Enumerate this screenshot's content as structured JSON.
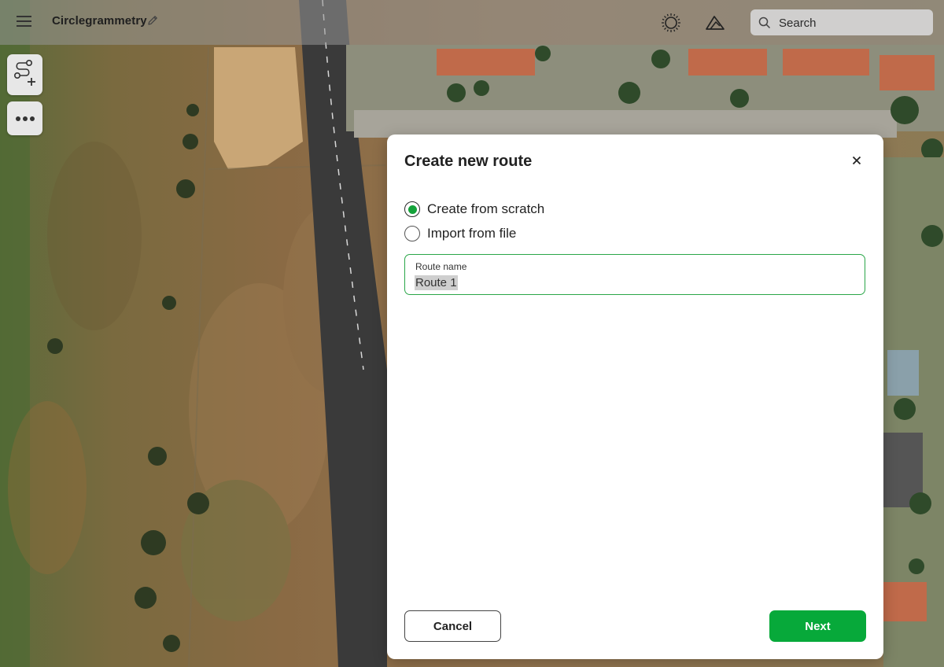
{
  "header": {
    "project_title": "Circlegrammetry",
    "search_placeholder": "Search"
  },
  "icons": {
    "menu": "hamburger-icon",
    "edit": "pencil-icon",
    "sun": "sun-icon",
    "terrain": "mountain-icon",
    "search": "search-icon",
    "route_tool": "route-add-icon",
    "more": "more-dots-icon",
    "close": "close-icon"
  },
  "dialog": {
    "title": "Create new route",
    "options": [
      {
        "label": "Create from scratch",
        "selected": true
      },
      {
        "label": "Import from file",
        "selected": false
      }
    ],
    "route_name_label": "Route name",
    "route_name_value": "Route 1",
    "cancel_label": "Cancel",
    "next_label": "Next"
  },
  "colors": {
    "accent_green": "#07a93a",
    "radio_green": "#14a23a",
    "field_border": "#2aa648"
  }
}
